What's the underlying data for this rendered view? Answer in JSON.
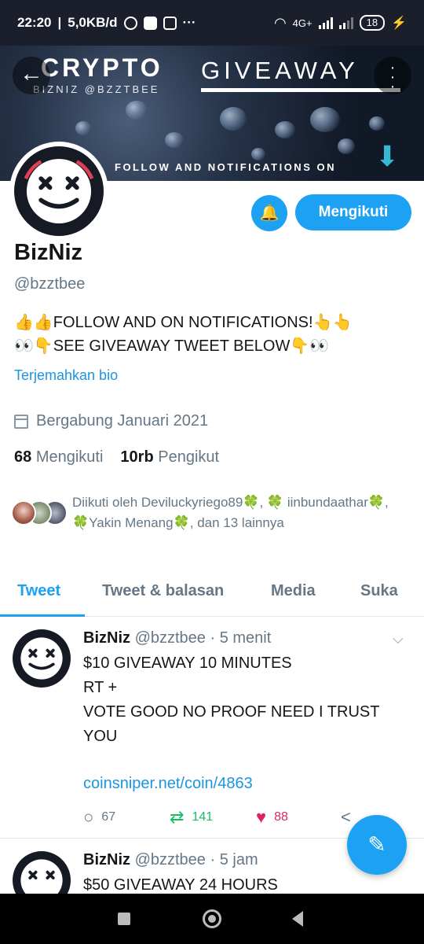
{
  "status_bar": {
    "time": "22:20",
    "speed": "5,0KB/d",
    "more": "···",
    "network": "4G+",
    "battery": "18"
  },
  "banner": {
    "brand": "CRYPTO",
    "brand_sub": "BIZNIZ @BZZTBEE",
    "headline": "GIVEAWAY",
    "cta": "FOLLOW AND NOTIFICATIONS ON",
    "arrow": "⬇"
  },
  "profile": {
    "name": "BizNiz",
    "handle": "@bzztbee",
    "bio_line1": "👍👍FOLLOW AND ON NOTIFICATIONS!👆👆",
    "bio_line2": "👀👇SEE GIVEAWAY TWEET BELOW👇👀",
    "translate_label": "Terjemahkan bio",
    "joined": "Bergabung Januari 2021",
    "following_count": "68",
    "following_label": "Mengikuti",
    "followers_count": "10rb",
    "followers_label": "Pengikut",
    "followed_by": "Diikuti oleh Deviluckyriego89🍀, 🍀 iinbundaathar🍀, 🍀Yakin Menang🍀, dan 13 lainnya",
    "follow_button": "Mengikuti"
  },
  "tabs": [
    {
      "label": "Tweet"
    },
    {
      "label": "Tweet & balasan"
    },
    {
      "label": "Media"
    },
    {
      "label": "Suka"
    }
  ],
  "tweets": [
    {
      "name": "BizNiz",
      "handle": "@bzztbee",
      "time": "· 5 menit",
      "body": "$10 GIVEAWAY 10 MINUTES\nRT +\nVOTE GOOD NO PROOF NEED I TRUST YOU",
      "link": "coinsniper.net/coin/4863",
      "replies": "67",
      "retweets": "141",
      "likes": "88"
    },
    {
      "name": "BizNiz",
      "handle": "@bzztbee",
      "time": "· 5 jam",
      "body": "$50 GIVEAWAY 24 HOURS"
    }
  ],
  "colors": {
    "accent": "#1da1f2",
    "retweet": "#17bf63",
    "like": "#e0245e"
  }
}
